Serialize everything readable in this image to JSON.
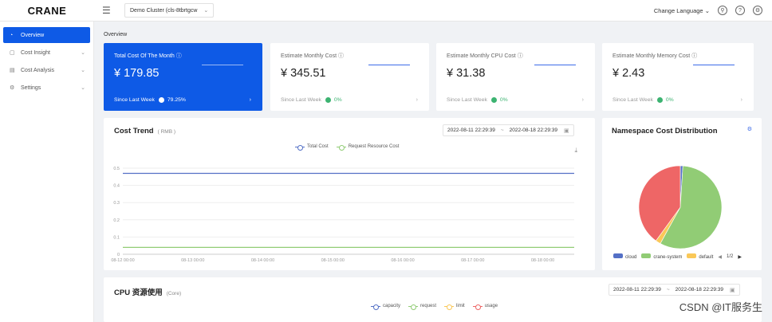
{
  "header": {
    "logo": "CRANE",
    "menu_icon": "hamburger-icon",
    "cluster": "Demo Cluster (cls-8tbrtgcw",
    "language": "Change Language"
  },
  "sidebar": {
    "items": [
      {
        "label": "Overview",
        "icon": "gauge-icon",
        "active": true
      },
      {
        "label": "Cost Insight",
        "icon": "file-icon",
        "expandable": true
      },
      {
        "label": "Cost Analysis",
        "icon": "list-icon",
        "expandable": true
      },
      {
        "label": "Settings",
        "icon": "gear-icon",
        "expandable": true
      }
    ]
  },
  "breadcrumb": "Overview",
  "stats": [
    {
      "title": "Total Cost Of The Month",
      "value": "¥ 179.85",
      "foot": "Since Last Week",
      "change": "79.25%"
    },
    {
      "title": "Estimate Monthly Cost",
      "value": "¥ 345.51",
      "foot": "Since Last Week",
      "change": "0%"
    },
    {
      "title": "Estimate Monthly CPU Cost",
      "value": "¥ 31.38",
      "foot": "Since Last Week",
      "change": "0%"
    },
    {
      "title": "Estimate Monthly Memory Cost",
      "value": "¥ 2.43",
      "foot": "Since Last Week",
      "change": "0%"
    }
  ],
  "cost_trend": {
    "title": "Cost Trend",
    "unit": "( RMB )",
    "range_start": "2022-08-11 22:29:39",
    "range_end": "2022-08-18 22:29:39"
  },
  "namespace": {
    "title": "Namespace Cost Distribution",
    "legend": [
      "cloud",
      "crane-system",
      "default"
    ],
    "pager": "1/2"
  },
  "cpu": {
    "title": "CPU 资源使用",
    "unit": "(Core)",
    "range_start": "2022-08-11 22:29:39",
    "range_end": "2022-08-18 22:29:39",
    "legend": [
      "capacity",
      "request",
      "limit",
      "usage"
    ]
  },
  "watermark": "CSDN @IT服务生",
  "colors": {
    "accent": "#0e5ae6",
    "series_total": "#5470c6",
    "series_request": "#91cc75",
    "pie_red": "#ee6666",
    "pie_yellow": "#fac858"
  },
  "chart_data": [
    {
      "type": "line",
      "title": "Cost Trend",
      "x": [
        "08-12 00:00",
        "08-13 00:00",
        "08-14 00:00",
        "08-15 00:00",
        "08-16 00:00",
        "08-17 00:00",
        "08-18 00:00"
      ],
      "yticks": [
        "0.5",
        "0.4",
        "0.3",
        "0.2",
        "0.1",
        "0"
      ],
      "ylim": [
        0,
        0.5
      ],
      "series": [
        {
          "name": "Total Cost",
          "values": [
            0.47,
            0.47,
            0.47,
            0.47,
            0.47,
            0.47,
            0.47
          ],
          "color": "#5470c6"
        },
        {
          "name": "Request Resource Cost",
          "values": [
            0.04,
            0.04,
            0.04,
            0.04,
            0.04,
            0.04,
            0.04
          ],
          "color": "#91cc75"
        }
      ],
      "grid": true,
      "legend": "top-center"
    },
    {
      "type": "pie",
      "title": "Namespace Cost Distribution",
      "slices": [
        {
          "name": "cloud",
          "value": 1,
          "color": "#5470c6"
        },
        {
          "name": "crane-system",
          "value": 57,
          "color": "#91cc75"
        },
        {
          "name": "default",
          "value": 2,
          "color": "#fac858"
        },
        {
          "name": "",
          "value": 40,
          "color": "#ee6666"
        }
      ]
    }
  ]
}
